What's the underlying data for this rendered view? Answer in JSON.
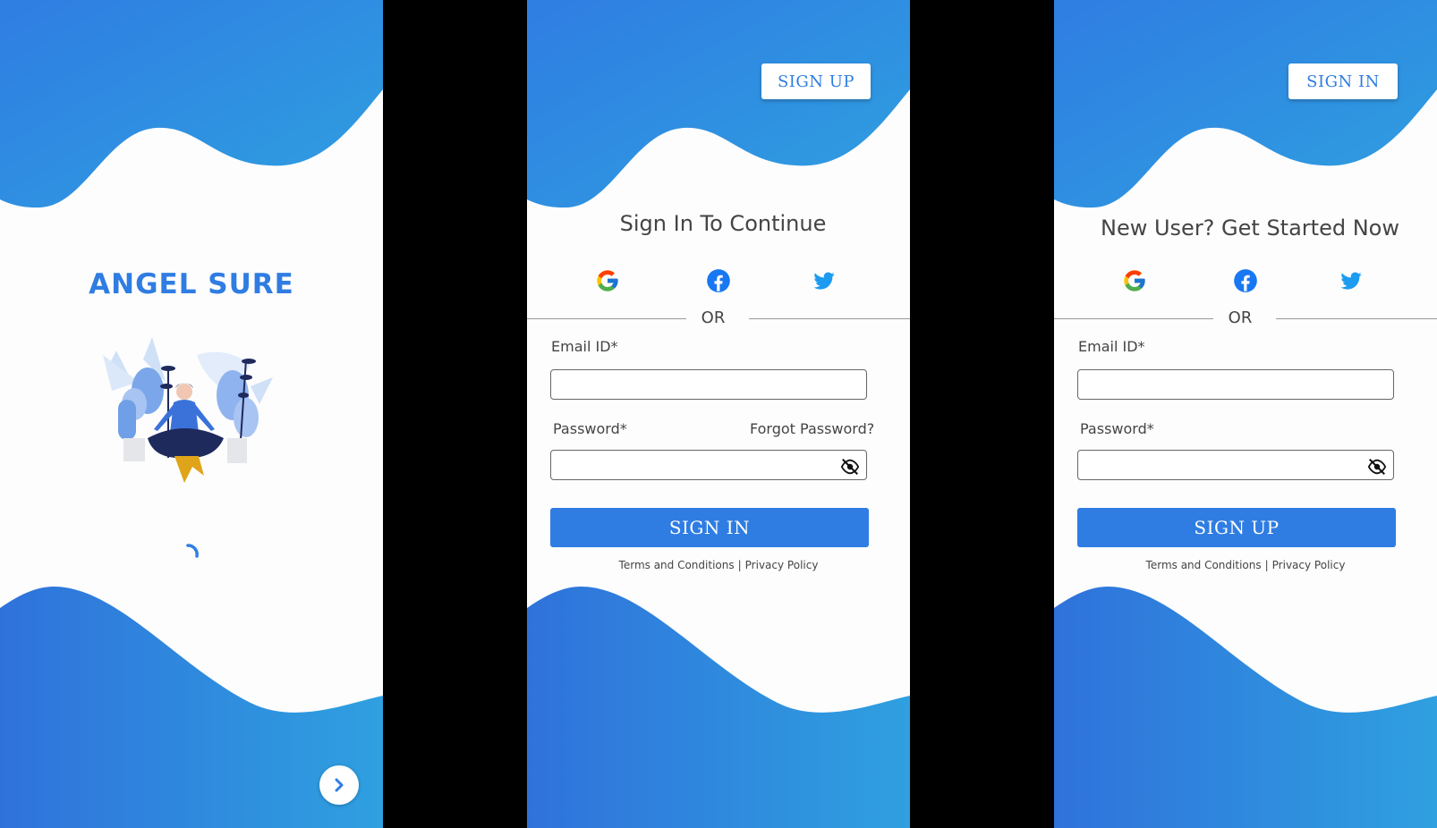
{
  "splash": {
    "brand": "ANGEL SURE",
    "next_icon": "chevron-right-icon"
  },
  "signin": {
    "top_button": "SIGN UP",
    "heading": "Sign In To Continue",
    "or_text": "OR",
    "email_label": "Email ID*",
    "password_label": "Password*",
    "forgot_label": "Forgot Password?",
    "submit_label": "SIGN IN",
    "terms_label": "Terms and Conditions",
    "separator": "|",
    "privacy_label": "Privacy Policy"
  },
  "signup": {
    "top_button": "SIGN IN",
    "heading": "New User? Get Started Now",
    "or_text": "OR",
    "email_label": "Email ID*",
    "password_label": "Password*",
    "submit_label": "SIGN UP",
    "terms_label": "Terms and Conditions",
    "separator": "|",
    "privacy_label": "Privacy Policy"
  },
  "icons": [
    "google-icon",
    "facebook-icon",
    "twitter-icon",
    "eye-off-icon",
    "chevron-right-icon",
    "loading-spinner"
  ],
  "colors": {
    "accent": "#2f7de2",
    "wave_light": "#2f9ee0",
    "background": "#fdfdfd",
    "text": "#444444",
    "twitter": "#1d9bf0",
    "facebook": "#1877f2"
  }
}
